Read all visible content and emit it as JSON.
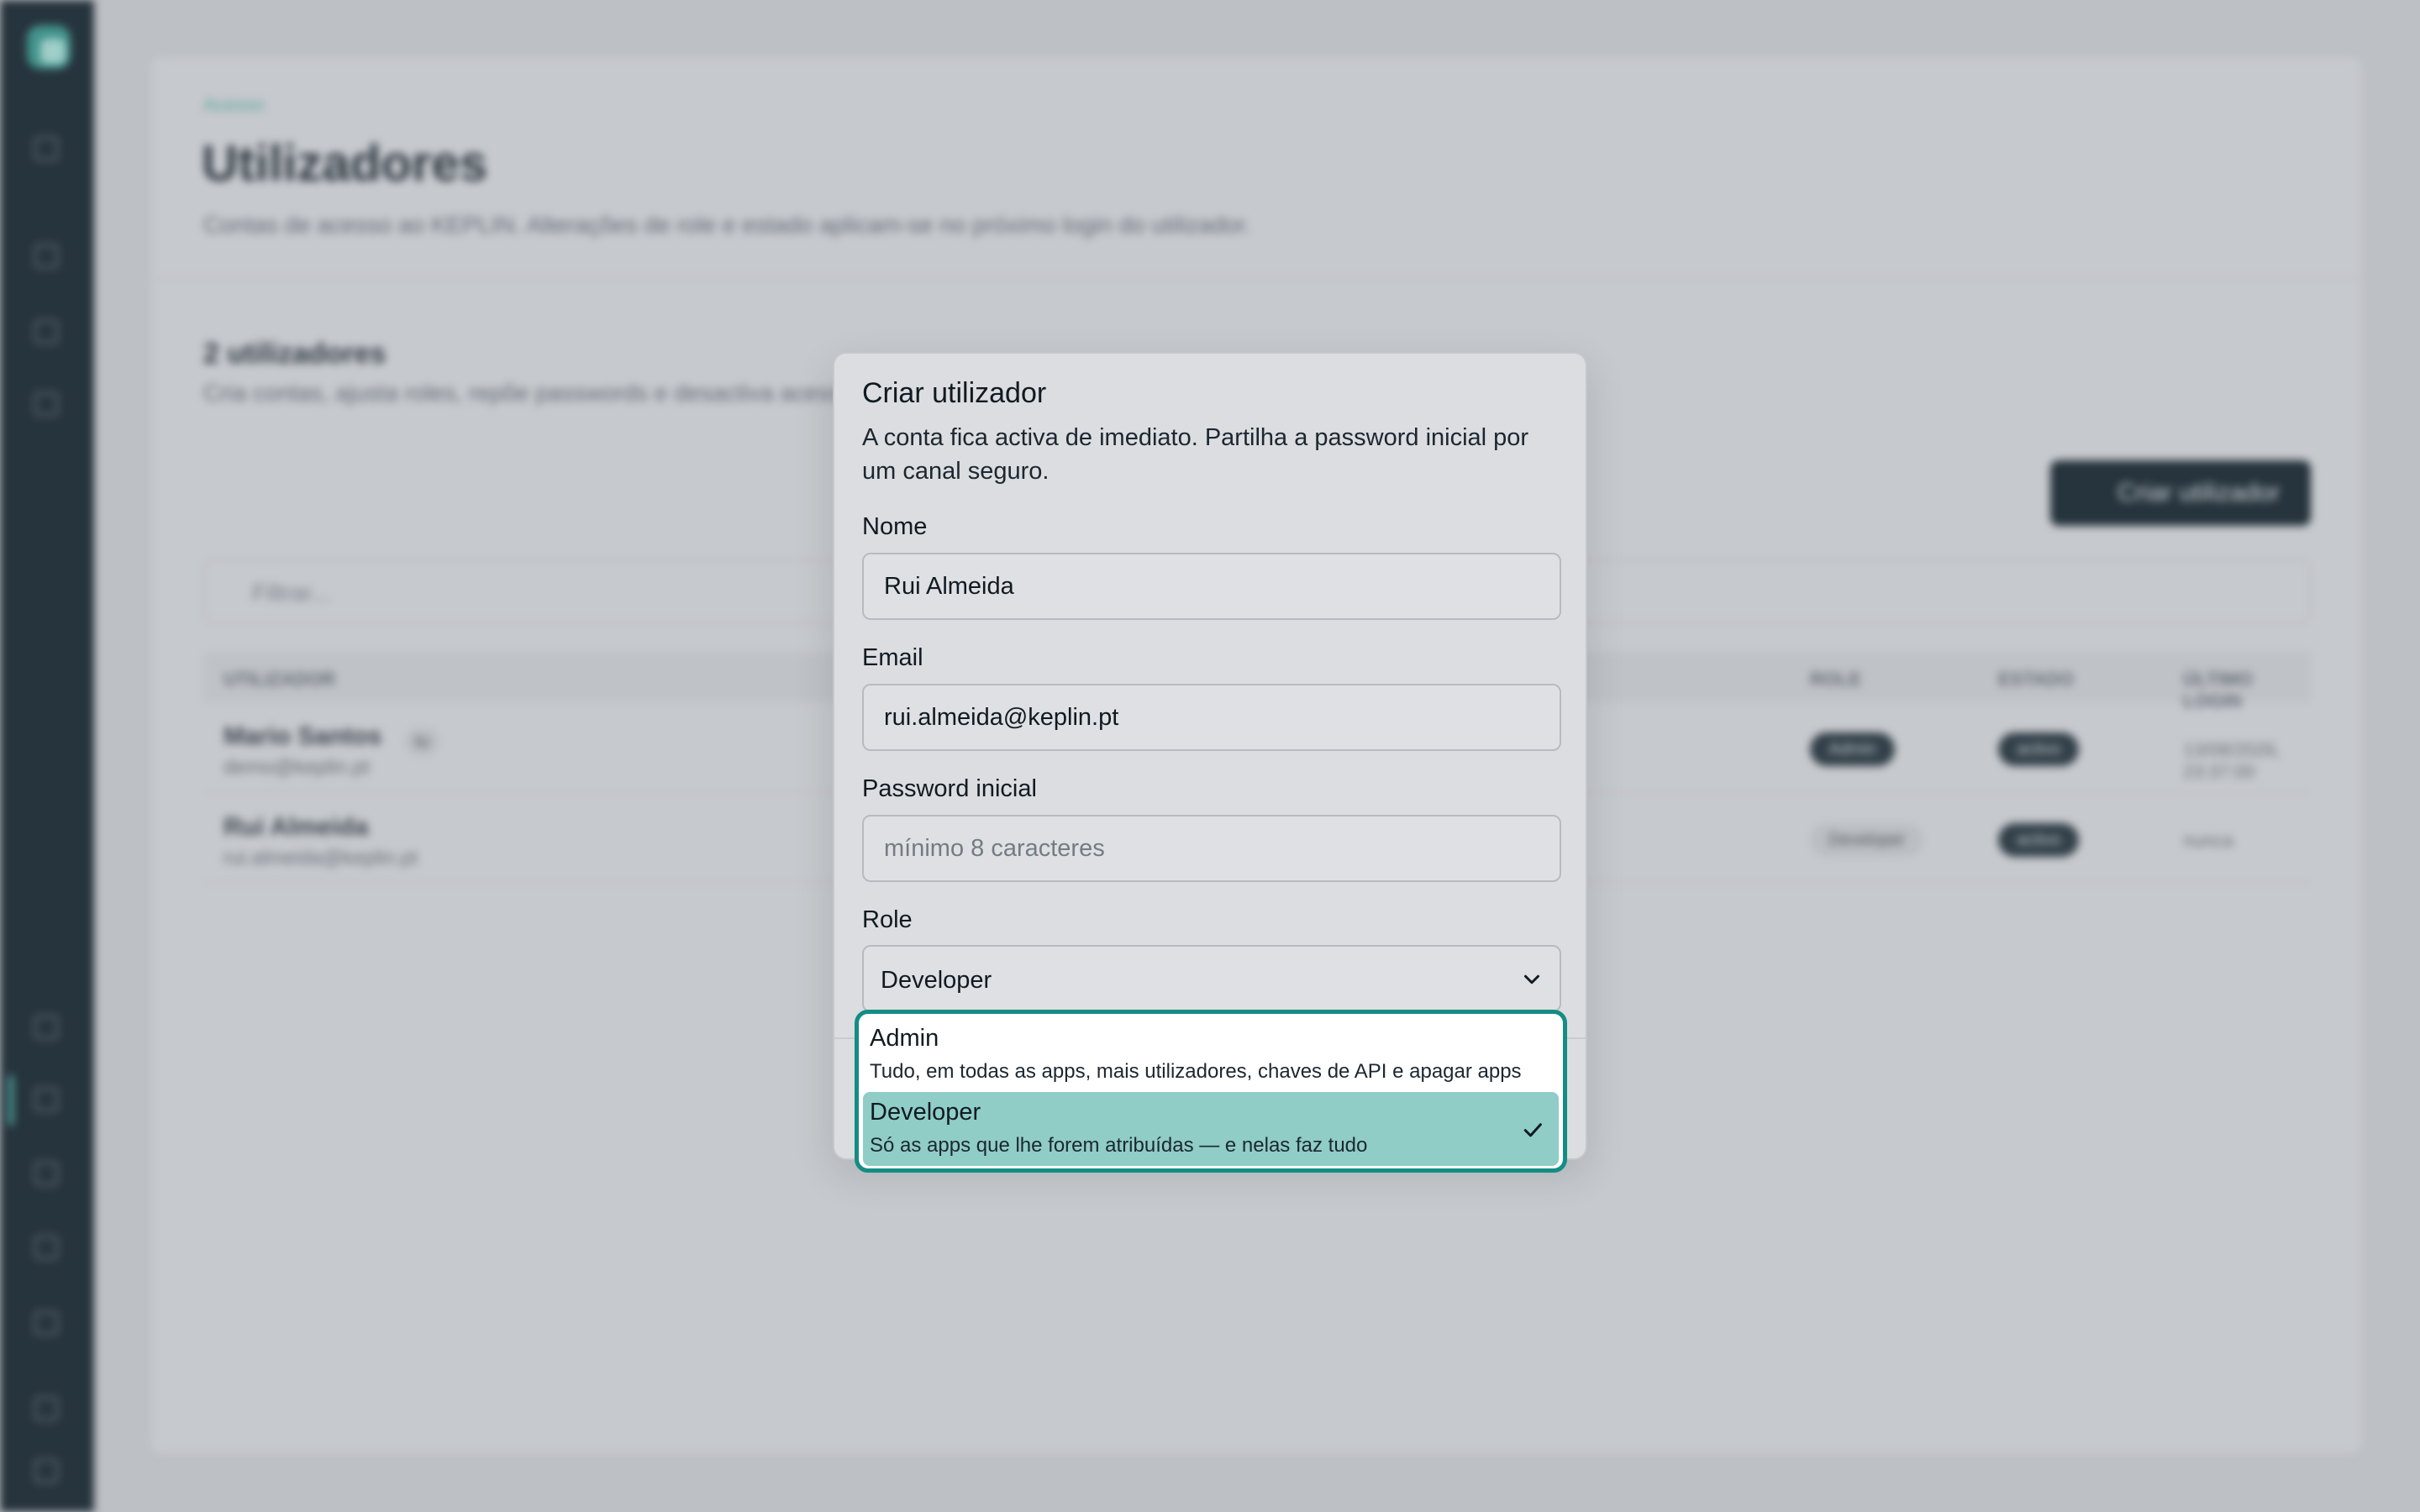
{
  "background": {
    "breadcrumb": "Acesso",
    "page_title": "Utilizadores",
    "page_subtitle": "Contas de acesso ao KEPLIN. Alterações de role e estado aplicam-se no próximo login do utilizador.",
    "section_title": "2 utilizadores",
    "section_subtitle": "Cria contas, ajusta roles, repõe passwords e desactiva acessos.",
    "create_button": "Criar utilizador",
    "filter_placeholder": "Filtrar...",
    "table": {
      "headers": [
        "UTILIZADOR",
        "ROLE",
        "ESTADO",
        "ÚLTIMO LOGIN"
      ],
      "rows": [
        {
          "name": "Mario Santos",
          "tag": "tu",
          "email": "demo@keplin.pt",
          "role": "Admin",
          "status": "activo",
          "last_login": "13/08/2026, 23:37:00"
        },
        {
          "name": "Rui Almeida",
          "email": "rui.almeida@keplin.pt",
          "role": "Developer",
          "status": "activo",
          "last_login": "nunca"
        }
      ]
    }
  },
  "modal": {
    "title": "Criar utilizador",
    "description": "A conta fica activa de imediato. Partilha a password inicial por um canal seguro.",
    "name_label": "Nome",
    "name_value": "Rui Almeida",
    "email_label": "Email",
    "email_value": "rui.almeida@keplin.pt",
    "password_label": "Password inicial",
    "password_placeholder": "mínimo 8 caracteres",
    "role_label": "Role",
    "role_value": "Developer"
  },
  "role_options": [
    {
      "title": "Admin",
      "description": "Tudo, em todas as apps, mais utilizadores, chaves de API e apagar apps",
      "selected": false
    },
    {
      "title": "Developer",
      "description": "Só as apps que lhe forem atribuídas — e nelas faz tudo",
      "selected": true
    }
  ],
  "colors": {
    "sidebar": "#0c1b25",
    "accent": "#138d84",
    "selected_option": "#8fcdc6"
  }
}
